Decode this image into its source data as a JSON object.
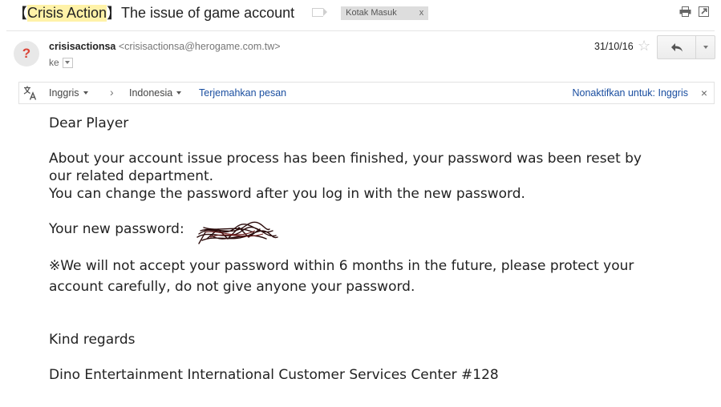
{
  "subject": {
    "bracket_open": "【",
    "highlight": "Crisis Action",
    "bracket_close": "】",
    "text": "The issue of game account"
  },
  "labels": {
    "inbox_chip": "Kotak Masuk",
    "inbox_chip_close": "x"
  },
  "icons": {
    "print": "print-icon",
    "popout": "new-window-icon",
    "avatar": "unknown-sender-icon",
    "star": "star-icon",
    "reply": "reply-icon",
    "more": "dropdown-arrow-icon",
    "translate": "translate-icon"
  },
  "sender": {
    "avatar_glyph": "?",
    "name": "crisisactionsa",
    "email": "<crisisactionsa@herogame.com.tw>",
    "to_label": "ke"
  },
  "date": "31/10/16",
  "star_glyph": "☆",
  "translate_bar": {
    "source_lang": "Inggris",
    "arrow": "›",
    "target_lang": "Indonesia",
    "translate_link": "Terjemahkan pesan",
    "disable_link": "Nonaktifkan untuk: Inggris",
    "close": "×"
  },
  "body": {
    "greeting": "Dear Player",
    "para1_line1": "About your account issue process has been finished, your password was been reset by",
    "para1_line2": "our related department.",
    "para1_line3": "You can change the password after you log in with the new password.",
    "password_label": "Your new password:",
    "warning_line1": "※We will not accept your password within 6 months in the future, please protect your",
    "warning_line2": "account carefully, do not give anyone your password.",
    "closing": "Kind regards",
    "signature": "Dino Entertainment International Customer Services Center #128"
  },
  "colors": {
    "highlight": "#fff2a8",
    "link": "#1a4ea0",
    "avatar_glyph": "#db4437",
    "redaction": "#2a0a0a"
  }
}
